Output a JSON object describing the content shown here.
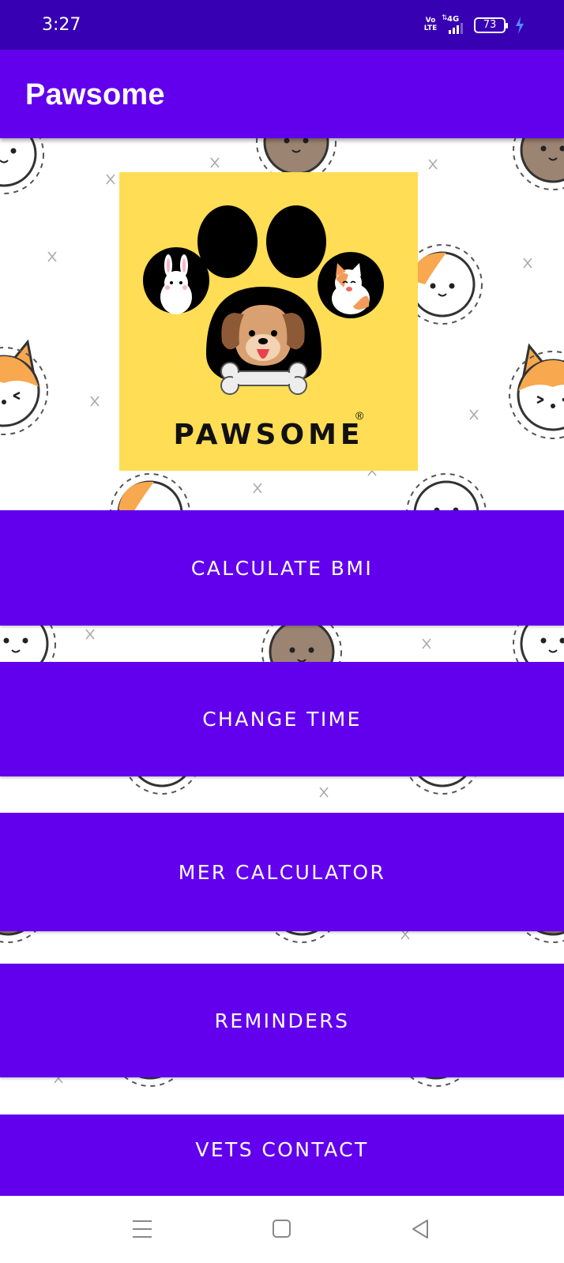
{
  "status_bar": {
    "time": "3:27",
    "volte": "Vo LTE",
    "network": "4G",
    "battery": "73",
    "icons": [
      "volte-icon",
      "signal-4g-icon",
      "battery-icon",
      "charging-bolt-icon"
    ]
  },
  "app_bar": {
    "title": "Pawsome"
  },
  "logo": {
    "text": "PAWSOME",
    "registered_mark": "®"
  },
  "menu": {
    "buttons": [
      {
        "label": "CALCULATE BMI"
      },
      {
        "label": "CHANGE TIME"
      },
      {
        "label": "MER CALCULATOR"
      },
      {
        "label": "REMINDERS"
      },
      {
        "label": "VETS CONTACT"
      }
    ]
  },
  "nav_bar": {
    "icons": [
      "recents-menu-icon",
      "home-square-icon",
      "back-triangle-icon"
    ]
  },
  "colors": {
    "status_bar": "#3700B3",
    "primary": "#6200EE",
    "logo_background": "#FFDD55",
    "button_text": "#FFFFFF"
  }
}
